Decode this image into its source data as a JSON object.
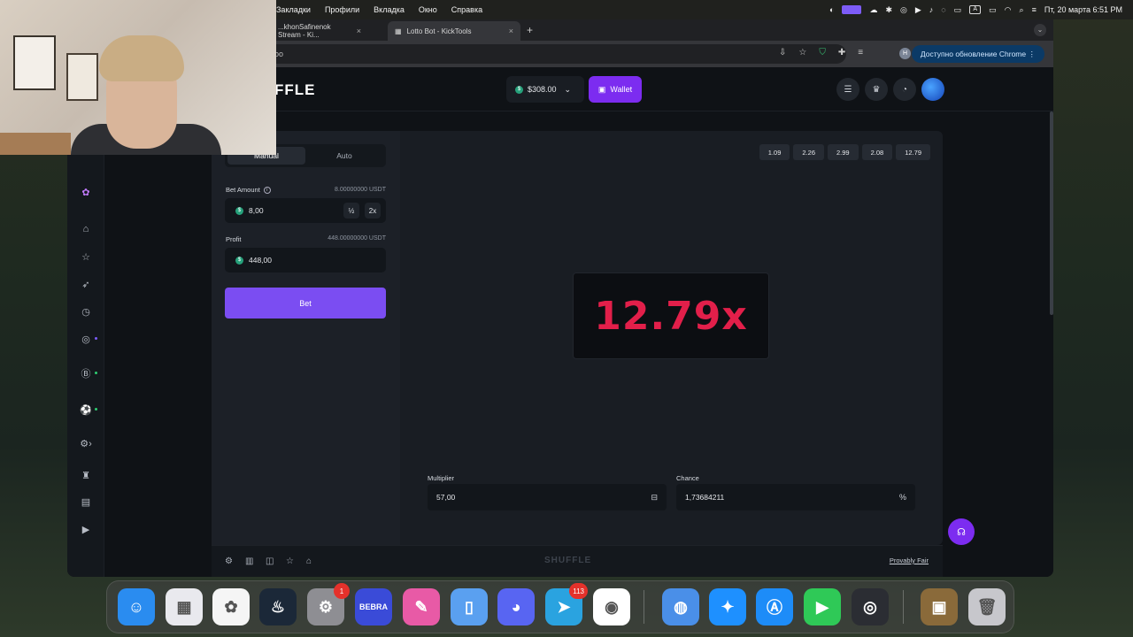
{
  "menubar": {
    "items": [
      "Закладки",
      "Профили",
      "Вкладка",
      "Окно",
      "Справка"
    ],
    "datetime": "Пт, 20 марта 6:51 PM"
  },
  "browser": {
    "tabs": [
      {
        "title": "...khonSafinenok Stream - Ki...",
        "close": "×"
      },
      {
        "title": "Lotto Bot - KickTools",
        "close": "×"
      }
    ],
    "new_tab": "+",
    "url_fragment": "oo",
    "update_label": "Доступно обновление Chrome",
    "profile_initial": "H"
  },
  "site": {
    "logo": "FFLE",
    "balance": "$308.00",
    "wallet_label": "Wallet"
  },
  "panel": {
    "tab_manual": "Manual",
    "tab_auto": "Auto",
    "bet_label": "Bet Amount",
    "bet_usdt": "8.00000000 USDT",
    "bet_value": "8,00",
    "half": "½",
    "double": "2x",
    "profit_label": "Profit",
    "profit_usdt": "448.00000000 USDT",
    "profit_value": "448,00",
    "bet_button": "Bet"
  },
  "game": {
    "history": [
      "1.09",
      "2.26",
      "2.99",
      "2.08",
      "12.79"
    ],
    "result": "12.79x",
    "multiplier_label": "Multiplier",
    "multiplier_value": "57,00",
    "chance_label": "Chance",
    "chance_value": "1,73684211",
    "chance_suffix": "%",
    "footer_logo": "SHUFFLE",
    "provably_fair": "Provably Fair"
  },
  "dock": {
    "apps": [
      {
        "name": "Finder",
        "color": "#2a8cf0"
      },
      {
        "name": "Launchpad",
        "color": "#e9e9ee"
      },
      {
        "name": "Photos",
        "color": "#f5f5f5"
      },
      {
        "name": "Steam",
        "color": "#1b2838"
      },
      {
        "name": "System Settings",
        "color": "#8e8e93",
        "badge": "1"
      },
      {
        "name": "BEBRA",
        "color": "#3a4bd8",
        "label": "BEBRA"
      },
      {
        "name": "Pages",
        "color": "#e85aa6"
      },
      {
        "name": "Simulator",
        "color": "#5aa0f0"
      },
      {
        "name": "Discord",
        "color": "#5865f2"
      },
      {
        "name": "Telegram",
        "color": "#2aa3e0",
        "badge": "113"
      },
      {
        "name": "Chrome",
        "color": "#ffffff"
      },
      {
        "name": "Tasks",
        "color": "#4a8fe8"
      },
      {
        "name": "Safari",
        "color": "#1e90ff"
      },
      {
        "name": "App Store",
        "color": "#1d8cf8"
      },
      {
        "name": "FaceTime",
        "color": "#2fc957"
      },
      {
        "name": "OBS",
        "color": "#2b2d33"
      },
      {
        "name": "Folder",
        "color": "#8a6a3a"
      },
      {
        "name": "Trash",
        "color": "#c7c7cc"
      }
    ]
  },
  "colors": {
    "accent": "#7b4df2",
    "wallet": "#7c2cf0",
    "result": "#e21f4a"
  }
}
